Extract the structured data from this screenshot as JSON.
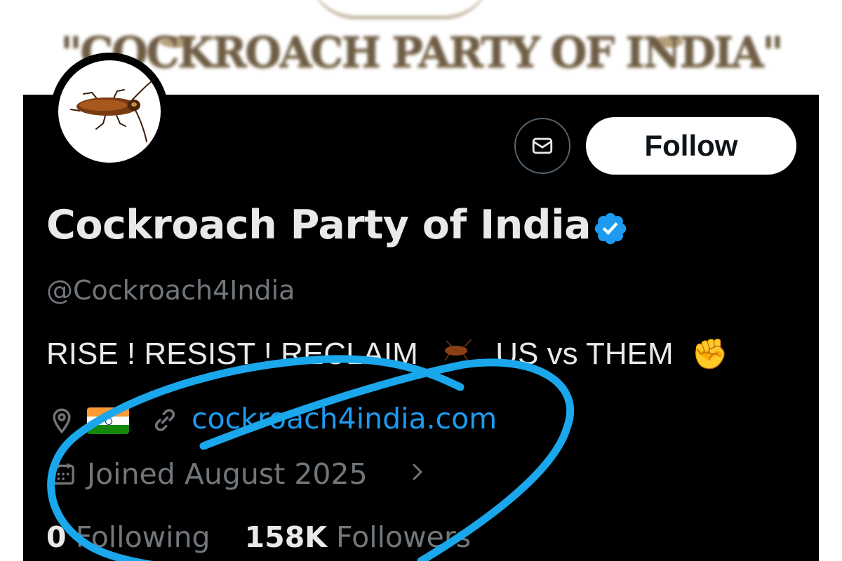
{
  "banner": {
    "title": "\"COCKROACH PARTY OF INDIA\""
  },
  "profile": {
    "follow_label": "Follow",
    "name": "Cockroach Party of India",
    "handle": "@Cockroach4India",
    "bio_part1": "RISE ! RESIST ! RECLAIM",
    "bio_part2": "US vs THEM",
    "bio_emoji_fist": "✊",
    "website": "cockroach4india.com",
    "joined": "Joined August 2025",
    "following_count": "0",
    "following_label": "Following",
    "followers_count": "158K",
    "followers_label": "Followers"
  },
  "icons": {
    "message": "envelope-icon",
    "verified": "verified-badge-icon",
    "location": "location-pin-icon",
    "link": "link-icon",
    "calendar": "calendar-icon",
    "chevron": "chevron-right-icon"
  },
  "colors": {
    "background": "#000000",
    "text_primary": "#e7e9ea",
    "text_secondary": "#71767b",
    "link": "#1d9bf0",
    "verified": "#1d9bf0",
    "annotation": "#1aa7ec"
  }
}
